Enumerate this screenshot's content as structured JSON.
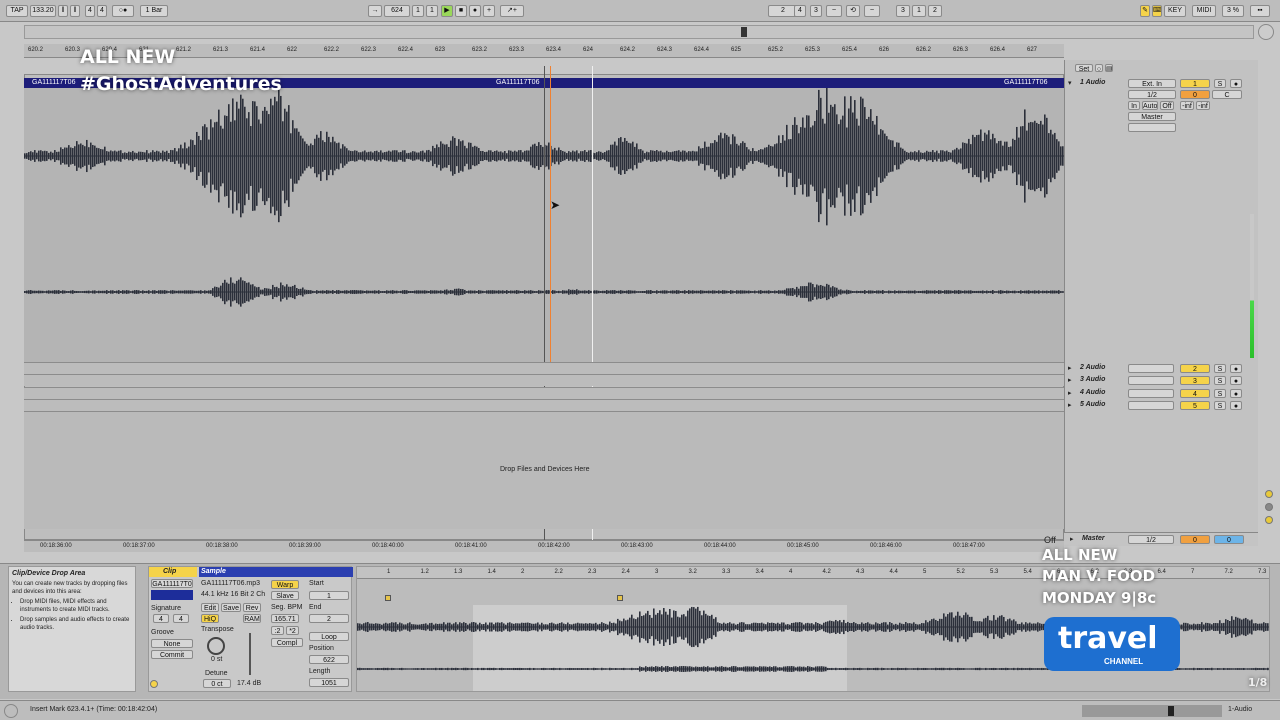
{
  "transport": {
    "tap": "TAP",
    "tempo": "133.20",
    "sig_num": "4",
    "sig_den": "4",
    "quant": "1 Bar",
    "pos_bar": "624",
    "pos_beat": "1",
    "pos_sixteenth": "1",
    "loop_start_a": "2",
    "loop_start_b": "4",
    "loop_start_c": "3",
    "loop_len_a": "3",
    "loop_len_b": "1",
    "loop_len_c": "2",
    "key": "KEY",
    "midi": "MIDI",
    "cpu": "3 %"
  },
  "ruler": {
    "ticks": [
      "620.2",
      "620.3",
      "620.4",
      "621",
      "621.2",
      "621.3",
      "621.4",
      "622",
      "622.2",
      "622.3",
      "622.4",
      "623",
      "623.2",
      "623.3",
      "623.4",
      "624",
      "624.2",
      "624.3",
      "624.4",
      "625",
      "625.2",
      "625.3",
      "625.4",
      "626",
      "626.2",
      "626.3",
      "626.4",
      "627"
    ],
    "times": [
      "00:18:36:00",
      "00:18:37:00",
      "00:18:38:00",
      "00:18:39:00",
      "00:18:40:00",
      "00:18:41:00",
      "00:18:42:00",
      "00:18:43:00",
      "00:18:44:00",
      "00:18:45:00",
      "00:18:46:00",
      "00:18:47:00"
    ]
  },
  "clip": {
    "name_left": "GA111117T06",
    "name_mid": "GA111117T06",
    "name_right": "GA111117T06"
  },
  "drop_area": "Drop Files and Devices Here",
  "mixer": {
    "set_label": "Set",
    "tracks": [
      {
        "name": "1 Audio",
        "num": "1",
        "color": "#f5d34a"
      },
      {
        "name": "2 Audio",
        "num": "2",
        "color": "#f5d34a"
      },
      {
        "name": "3 Audio",
        "num": "3",
        "color": "#f5d34a"
      },
      {
        "name": "4 Audio",
        "num": "4",
        "color": "#f5d34a"
      },
      {
        "name": "5 Audio",
        "num": "5",
        "color": "#f5d34a"
      }
    ],
    "input_type": "Ext. In",
    "input_channel": "1/2",
    "monitor": [
      "In",
      "Auto",
      "Off"
    ],
    "output": "Master",
    "vol": "-inf",
    "pan": "-inf",
    "solo": "S",
    "sends_a": "0",
    "sends_c": "C",
    "master": "Master",
    "master_out": "1/2",
    "master_zero": "0",
    "master_zero2": "0",
    "off": "Off"
  },
  "info_panel": {
    "title": "Clip/Device Drop Area",
    "intro": "You can create new tracks by dropping files and devices into this area:",
    "bullet1": "Drop MIDI files, MIDI effects and instruments to create MIDI tracks.",
    "bullet2": "Drop samples and audio effects to create audio tracks."
  },
  "clip_view": {
    "clip_tab": "Clip",
    "sample_tab": "Sample",
    "clip_name": "GA111117T0",
    "sample_file": "GA111117T06.mp3",
    "sample_info": "44.1 kHz 16 Bit 2 Ch",
    "signature": "Signature",
    "sig_a": "4",
    "sig_b": "4",
    "groove": "Groove",
    "groove_val": "None",
    "commit": "Commit",
    "edit": "Edit",
    "save": "Save",
    "rev": "Rev",
    "hiq": "HiQ",
    "ram": "RAM",
    "transpose": "Transpose",
    "transpose_val": "0 st",
    "detune": "Detune",
    "detune_val": "0 ct",
    "gain": "17.4 dB",
    "warp": "Warp",
    "slave": "Slave",
    "seg_bpm": "Seg. BPM",
    "bpm_val": "165.71",
    "half": ":2",
    "double": "*2",
    "complex": "Compl",
    "start": "Start",
    "start_val": "1",
    "end": "End",
    "end_val": "2",
    "loop": "Loop",
    "position": "Position",
    "pos_val": "622",
    "length": "Length",
    "len_val": "1051"
  },
  "sample_ruler": [
    "1",
    "1.2",
    "1.3",
    "1.4",
    "2",
    "2.2",
    "2.3",
    "2.4",
    "3",
    "3.2",
    "3.3",
    "3.4",
    "4",
    "4.2",
    "4.3",
    "4.4",
    "5",
    "5.2",
    "5.3",
    "5.4",
    "6",
    "6.2",
    "6.3",
    "6.4",
    "7",
    "7.2",
    "7.3"
  ],
  "status": {
    "text": "Insert Mark 623.4.1+ (Time: 00:18:42:04)",
    "track": "1-Audio"
  },
  "overlays": {
    "top_line1": "ALL NEW",
    "top_line2": "#GhostAdventures",
    "promo1": "ALL NEW",
    "promo2": "MAN V. FOOD",
    "promo3": "MONDAY 9|8c",
    "logo1": "travel",
    "logo2": "CHANNEL",
    "page": "1/8"
  }
}
